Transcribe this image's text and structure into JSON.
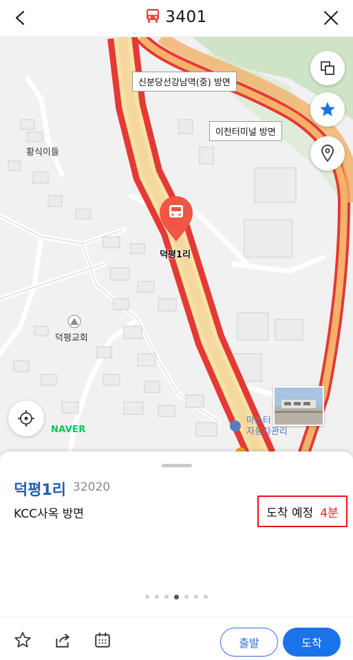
{
  "header": {
    "route_number": "3401",
    "back_icon": "chevron-left-icon",
    "close_icon": "close-icon",
    "bus_icon": "bus-icon",
    "accent_color": "#e8443a"
  },
  "map": {
    "callouts": [
      "신분당선강남역(중) 방면",
      "이천터미널 방면"
    ],
    "places": {
      "hwangsik": "황식이들",
      "church": "덕평교회",
      "master_line1": "마스터",
      "master_line2": "자동차관리",
      "stop_marker": "덕평1리"
    },
    "logo": "NAVER",
    "buttons": [
      "layers-icon",
      "star-icon",
      "place-pin-icon",
      "locate-icon"
    ]
  },
  "sheet": {
    "stop_name": "덕평1리",
    "stop_id": "32020",
    "direction": "KCC사옥 방면",
    "arrival_label": "도착 예정",
    "arrival_time": "4분",
    "page_count": 7,
    "active_page": 4
  },
  "bottom_bar": {
    "icons": [
      "star-outline-icon",
      "share-icon",
      "calendar-icon"
    ],
    "depart_label": "출발",
    "arrive_label": "도착",
    "primary_color": "#1a73e8"
  }
}
